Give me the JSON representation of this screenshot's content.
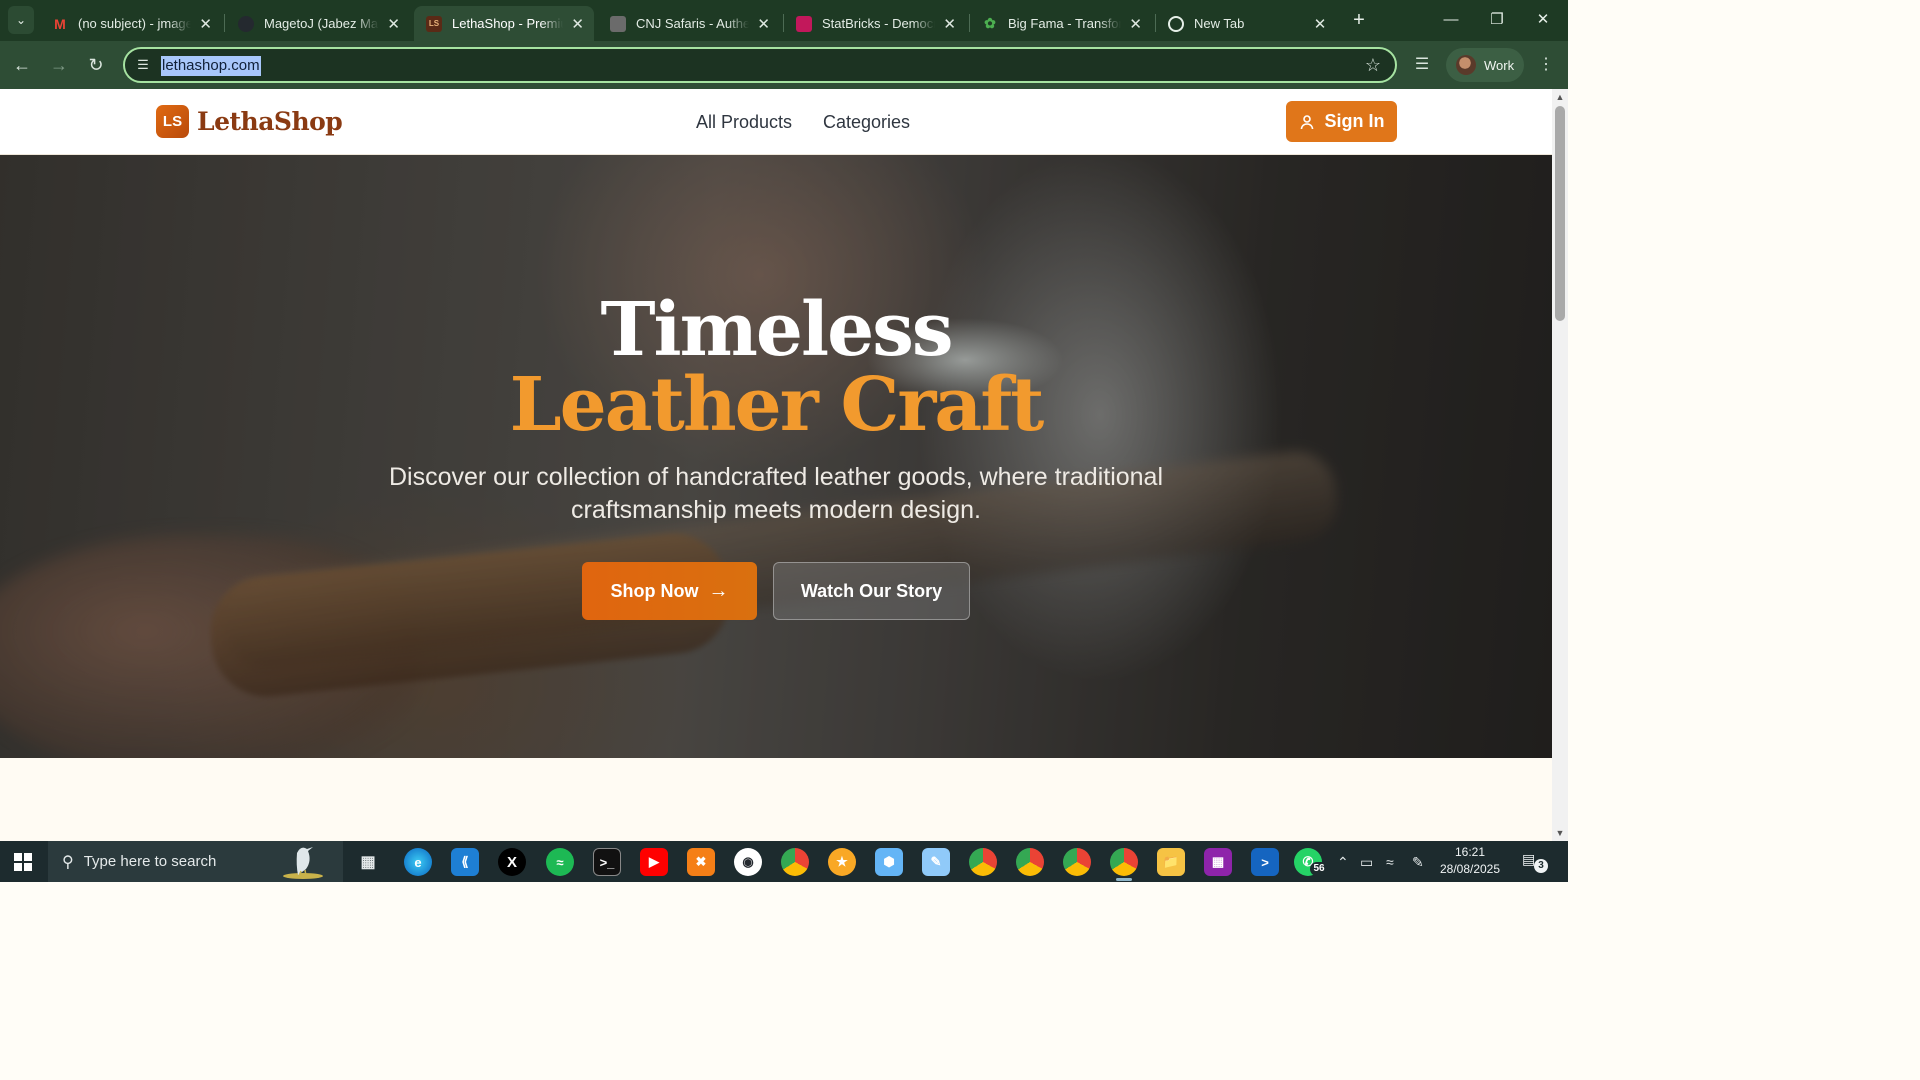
{
  "browser": {
    "tabs": [
      {
        "title": "(no subject) - jmageto@gmail.com",
        "favicon": "gmail-icon",
        "favicon_color": "#ea4335",
        "favicon_text": "M"
      },
      {
        "title": "MagetoJ (Jabez Mageto) · GitHub",
        "favicon": "github-icon",
        "favicon_color": "#24292f",
        "favicon_text": ""
      },
      {
        "title": "LethaShop - Premium Leather Goods",
        "favicon": "lethashop-icon",
        "favicon_color": "#5a2a16",
        "favicon_text": "LS"
      },
      {
        "title": "CNJ Safaris - Authentic Safari",
        "favicon": "cnj-icon",
        "favicon_color": "#6b6b6b",
        "favicon_text": ""
      },
      {
        "title": "StatBricks - Democratizing Data",
        "favicon": "statbricks-icon",
        "favicon_color": "#c2185b",
        "favicon_text": ""
      },
      {
        "title": "Big Fama - Transforming Ideas",
        "favicon": "bigfama-icon",
        "favicon_color": "#2e7d32",
        "favicon_text": ""
      },
      {
        "title": "New Tab",
        "favicon": "chrome-icon",
        "favicon_color": "#e6efe8",
        "favicon_text": ""
      }
    ],
    "active_tab": 2,
    "url": "lethashop.com",
    "profile_label": "Work"
  },
  "site": {
    "logo_badge": "LS",
    "brand": "LethaShop",
    "nav": [
      "All Products",
      "Categories"
    ],
    "signin_label": "Sign In",
    "accent": "#e0761a",
    "brand_color": "#8a3a12"
  },
  "hero": {
    "title_line1": "Timeless",
    "title_line2": "Leather Craft",
    "subtitle": "Discover our collection of handcrafted leather goods, where traditional craftsmanship meets modern design.",
    "primary_cta": "Shop Now",
    "secondary_cta": "Watch Our Story",
    "title_accent": "#f29a2e"
  },
  "taskbar": {
    "search_placeholder": "Type here to search",
    "time": "16:21",
    "date": "28/08/2025",
    "whatsapp_badge": "56",
    "notification_count": "3"
  }
}
